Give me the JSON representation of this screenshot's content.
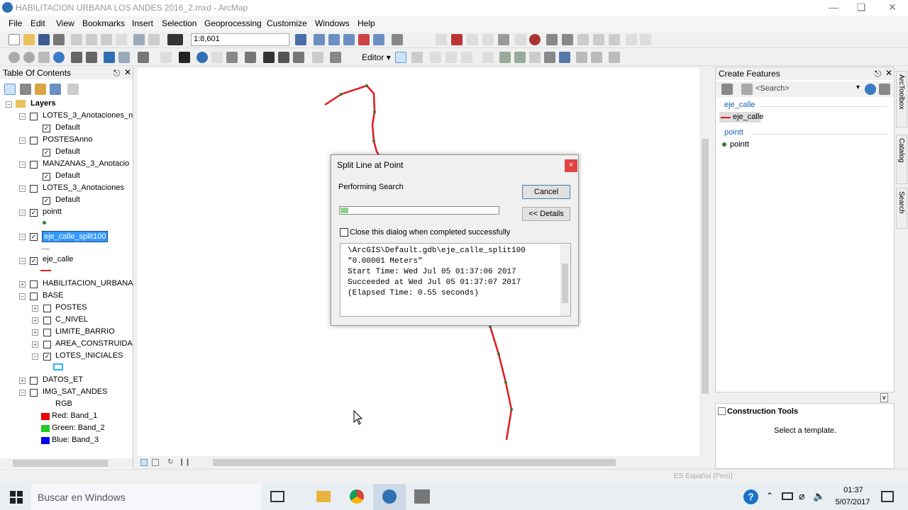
{
  "window": {
    "title": "HABILITACION URBANA LOS ANDES 2016_2.mxd - ArcMap"
  },
  "menu": [
    "File",
    "Edit",
    "View",
    "Bookmarks",
    "Insert",
    "Selection",
    "Geoprocessing",
    "Customize",
    "Windows",
    "Help"
  ],
  "toolbar": {
    "scale": "1:8,601",
    "editor_label": "Editor"
  },
  "toc": {
    "title": "Table Of Contents",
    "root": "Layers",
    "items": [
      {
        "label": "LOTES_3_Anotaciones_n",
        "checked": false
      },
      {
        "label": "Default",
        "checked": true
      },
      {
        "label": "POSTESAnno",
        "checked": false
      },
      {
        "label": "Default",
        "checked": true
      },
      {
        "label": "MANZANAS_3_Anotacio",
        "checked": false
      },
      {
        "label": "Default",
        "checked": true
      },
      {
        "label": "LOTES_3_Anotaciones",
        "checked": false
      },
      {
        "label": "Default",
        "checked": true
      },
      {
        "label": "pointt",
        "checked": true
      },
      {
        "label": "eje_calle_split100",
        "checked": true
      },
      {
        "label": "eje_calle",
        "checked": true
      },
      {
        "label": "HABILITACION_URBANA",
        "checked": false
      },
      {
        "label": "BASE",
        "checked": false
      },
      {
        "label": "POSTES",
        "checked": false
      },
      {
        "label": "C_NIVEL",
        "checked": false
      },
      {
        "label": "LIMITE_BARRIO",
        "checked": false
      },
      {
        "label": "AREA_CONSTRUIDA",
        "checked": false
      },
      {
        "label": "LOTES_INICIALES",
        "checked": true
      },
      {
        "label": "DATOS_ET",
        "checked": false
      },
      {
        "label": "IMG_SAT_ANDES",
        "checked": false
      }
    ],
    "rgb": {
      "label": "RGB",
      "red": "Red:",
      "red_band": "Band_1",
      "green": "Green:",
      "green_band": "Band_2",
      "blue": "Blue:",
      "blue_band": "Band_3"
    }
  },
  "dialog": {
    "title": "Split Line at Point",
    "status": "Performing Search",
    "cancel": "Cancel",
    "details": "<< Details",
    "close_option": "Close this dialog when completed successfully",
    "progress": 0.05,
    "log": [
      "\\ArcGIS\\Default.gdb\\eje_calle_split100",
      "\"0.00001 Meters\"",
      "Start Time: Wed Jul 05 01:37:06 2017",
      "Succeeded at Wed Jul 05 01:37:07 2017",
      "(Elapsed Time: 0.55 seconds)"
    ]
  },
  "create_features": {
    "title": "Create Features",
    "search_placeholder": "<Search>",
    "group1": "eje_calle",
    "item1": "eje_calle",
    "group2": "pointt",
    "item2": "pointt"
  },
  "construction": {
    "title": "Construction Tools",
    "hint": "Select a template."
  },
  "side_tabs": [
    "ArcToolbox",
    "Catalog",
    "Search"
  ],
  "status_bar": {
    "language": "ES Español (Perú)"
  },
  "taskbar": {
    "search": "Buscar en Windows",
    "time": "01:37",
    "date": "5/07/2017"
  },
  "colors": {
    "line": "#e31a1c",
    "vertex": "#2e7d32",
    "selection": "#3399ff"
  }
}
